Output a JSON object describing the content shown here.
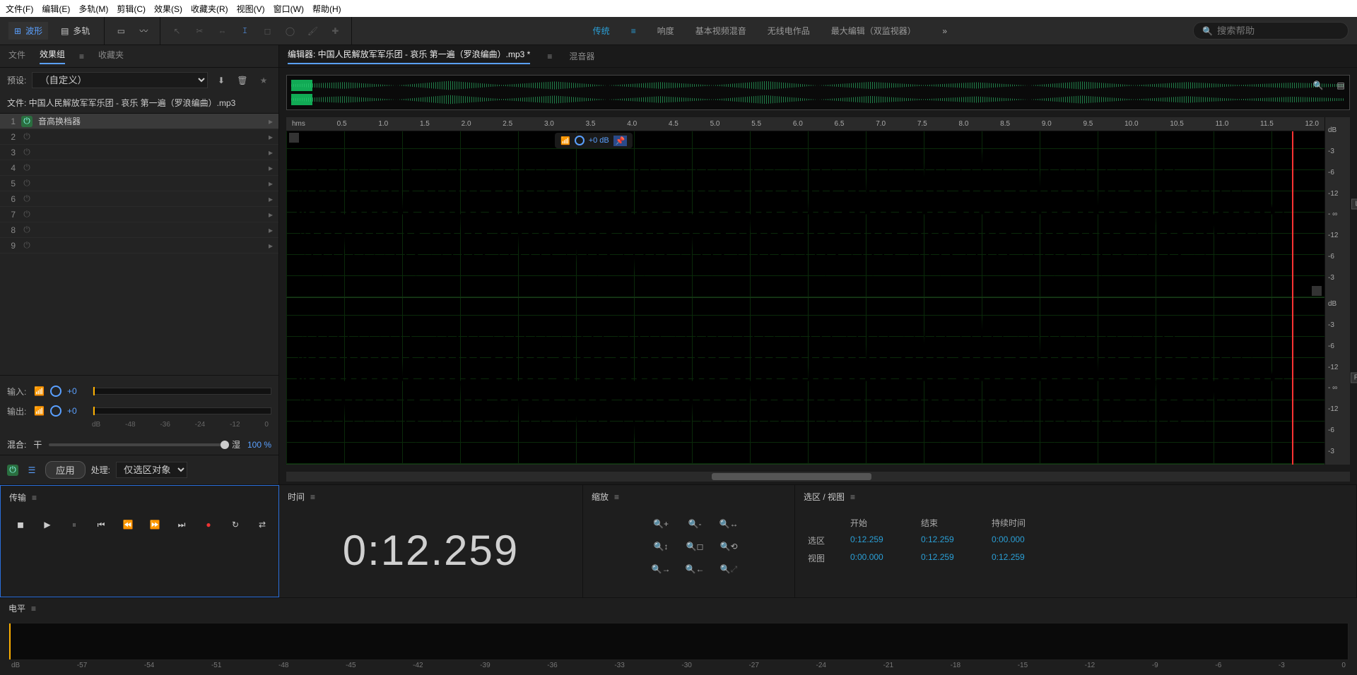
{
  "menubar": [
    "文件(F)",
    "编辑(E)",
    "多轨(M)",
    "剪辑(C)",
    "效果(S)",
    "收藏夹(R)",
    "视图(V)",
    "窗口(W)",
    "帮助(H)"
  ],
  "toolbar": {
    "waveform": "波形",
    "multitrack": "多轨"
  },
  "workspaces": {
    "items": [
      "传统",
      "响度",
      "基本视频混音",
      "无线电作品",
      "最大编辑（双监视器）"
    ],
    "active": 0
  },
  "search_placeholder": "搜索帮助",
  "left": {
    "tabs": [
      "文件",
      "效果组",
      "收藏夹"
    ],
    "preset_label": "预设:",
    "preset_value": "（自定义）",
    "file_label": "文件: 中国人民解放军军乐团 - 哀乐 第一遍（罗浪编曲）.mp3",
    "fx": [
      {
        "n": "1",
        "on": true,
        "name": "音高换档器"
      },
      {
        "n": "2",
        "on": false,
        "name": ""
      },
      {
        "n": "3",
        "on": false,
        "name": ""
      },
      {
        "n": "4",
        "on": false,
        "name": ""
      },
      {
        "n": "5",
        "on": false,
        "name": ""
      },
      {
        "n": "6",
        "on": false,
        "name": ""
      },
      {
        "n": "7",
        "on": false,
        "name": ""
      },
      {
        "n": "8",
        "on": false,
        "name": ""
      },
      {
        "n": "9",
        "on": false,
        "name": ""
      }
    ],
    "input_label": "输入:",
    "output_label": "输出:",
    "io_value": "+0",
    "db_ticks": [
      "dB",
      "-48",
      "-36",
      "-24",
      "-12",
      "0"
    ],
    "mix_label": "混合:",
    "mix_dry": "干",
    "mix_wet": "湿",
    "mix_value": "100 %",
    "apply": "应用",
    "process_label": "处理:",
    "process_value": "仅选区对象"
  },
  "editor": {
    "tab_editor": "编辑器: 中国人民解放军军乐团 - 哀乐 第一遍（罗浪编曲）.mp3 *",
    "tab_mixer": "混音器",
    "ruler_unit": "hms",
    "ruler_ticks": [
      "0.5",
      "1.0",
      "1.5",
      "2.0",
      "2.5",
      "3.0",
      "3.5",
      "4.0",
      "4.5",
      "5.0",
      "5.5",
      "6.0",
      "6.5",
      "7.0",
      "7.5",
      "8.0",
      "8.5",
      "9.0",
      "9.5",
      "10.0",
      "10.5",
      "11.0",
      "11.5",
      "12.0"
    ],
    "vol_db": "+0 dB",
    "db_scale": [
      "dB",
      "-3",
      "-6",
      "-12",
      "- ∞",
      "-12",
      "-6",
      "-3"
    ],
    "ch_L": "L",
    "ch_R": "R"
  },
  "transport": {
    "title": "传输"
  },
  "time": {
    "title": "时间",
    "value": "0:12.259"
  },
  "zoom": {
    "title": "缩放"
  },
  "selview": {
    "title": "选区 / 视图",
    "headers": [
      "开始",
      "结束",
      "持续时间"
    ],
    "rows": [
      {
        "label": "选区",
        "start": "0:12.259",
        "end": "0:12.259",
        "dur": "0:00.000"
      },
      {
        "label": "视图",
        "start": "0:00.000",
        "end": "0:12.259",
        "dur": "0:12.259"
      }
    ]
  },
  "levels": {
    "title": "电平",
    "ticks": [
      "dB",
      "-57",
      "-54",
      "-51",
      "-48",
      "-45",
      "-42",
      "-39",
      "-36",
      "-33",
      "-30",
      "-27",
      "-24",
      "-21",
      "-18",
      "-15",
      "-12",
      "-9",
      "-6",
      "-3",
      "0"
    ]
  }
}
